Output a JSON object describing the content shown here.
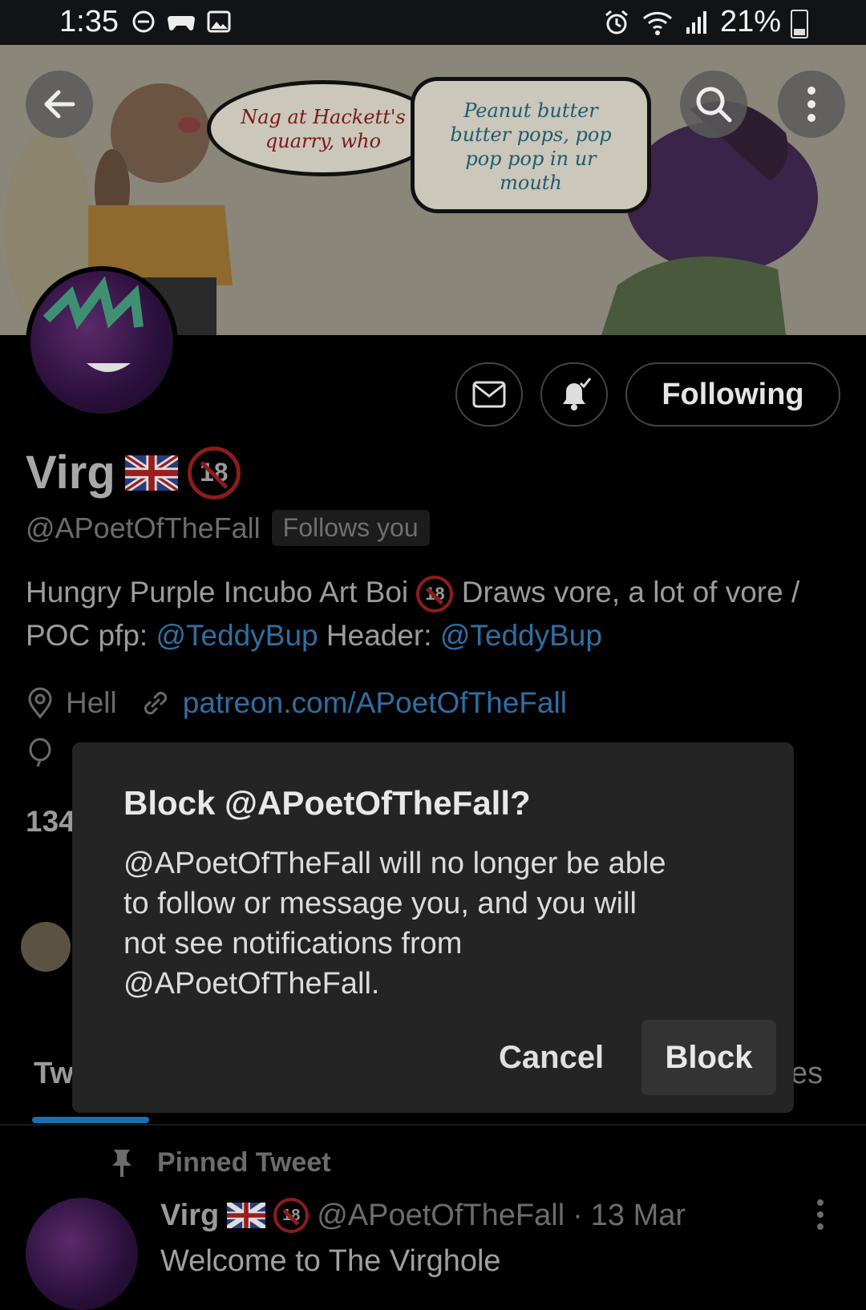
{
  "status_bar": {
    "time": "1:35",
    "battery_percent": "21%",
    "left_icons": [
      "do-not-disturb-icon",
      "gamepad-icon",
      "image-icon"
    ],
    "right_icons": [
      "alarm-icon",
      "wifi-icon",
      "signal-icon",
      "battery-icon"
    ]
  },
  "banner": {
    "speech_bubble_1": "Nag at Hackett's quarry, who",
    "speech_bubble_2": "Peanut butter butter pops, pop pop pop in ur mouth"
  },
  "profile": {
    "display_name": "Virg",
    "age_badge": "18",
    "handle": "@APoetOfTheFall",
    "follows_you_label": "Follows you",
    "following_button_label": "Following",
    "bio_part_1": "Hungry Purple Incubo Art Boi",
    "bio_age_badge": "18",
    "bio_part_2": "Draws vore, a lot of vore / POC  pfp:",
    "bio_mention_1": "@TeddyBup",
    "bio_part_3": "Header:",
    "bio_mention_2": "@TeddyBup",
    "location": "Hell",
    "website": "patreon.com/APoetOfTheFall",
    "stats_partial": "134"
  },
  "tabs": {
    "first_tab_partial": "Tw",
    "last_tab_partial": "es"
  },
  "pinned_tweet": {
    "pinned_label": "Pinned Tweet",
    "author_name": "Virg",
    "age_badge": "18",
    "author_handle": "@APoetOfTheFall",
    "dot": "·",
    "date": "13 Mar",
    "text": "Welcome to The Virghole"
  },
  "dialog": {
    "title": "Block @APoetOfTheFall?",
    "body": "@APoetOfTheFall will no longer be able to follow or message you, and you will not see notifications from @APoetOfTheFall.",
    "cancel_label": "Cancel",
    "block_label": "Block"
  },
  "colors": {
    "link": "#2e6fa1",
    "tab_indicator": "#1c6fb0",
    "dialog_bg": "#242424",
    "age_badge_red": "#8b1d1d"
  }
}
